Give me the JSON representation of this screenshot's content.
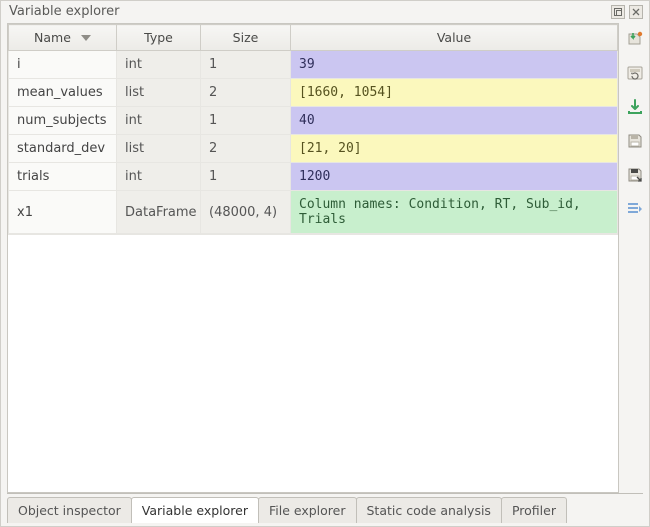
{
  "title": "Variable explorer",
  "columns": {
    "name": "Name",
    "type": "Type",
    "size": "Size",
    "value": "Value"
  },
  "rows": [
    {
      "name": "i",
      "type": "int",
      "size": "1",
      "value": "39",
      "vclass": "val-int"
    },
    {
      "name": "mean_values",
      "type": "list",
      "size": "2",
      "value": "[1660, 1054]",
      "vclass": "val-list"
    },
    {
      "name": "num_subjects",
      "type": "int",
      "size": "1",
      "value": "40",
      "vclass": "val-int"
    },
    {
      "name": "standard_dev",
      "type": "list",
      "size": "2",
      "value": "[21, 20]",
      "vclass": "val-list"
    },
    {
      "name": "trials",
      "type": "int",
      "size": "1",
      "value": "1200",
      "vclass": "val-int"
    },
    {
      "name": "x1",
      "type": "DataFrame",
      "size": "(48000, 4)",
      "value": "Column names: Condition, RT, Sub_id, Trials",
      "vclass": "val-df"
    }
  ],
  "tabs": [
    {
      "label": "Object inspector",
      "active": false
    },
    {
      "label": "Variable explorer",
      "active": true
    },
    {
      "label": "File explorer",
      "active": false
    },
    {
      "label": "Static code analysis",
      "active": false
    },
    {
      "label": "Profiler",
      "active": false
    }
  ],
  "toolbar_icons": [
    "import-icon",
    "refresh-icon",
    "import-data-icon",
    "save-icon",
    "save-as-icon",
    "options-icon"
  ]
}
